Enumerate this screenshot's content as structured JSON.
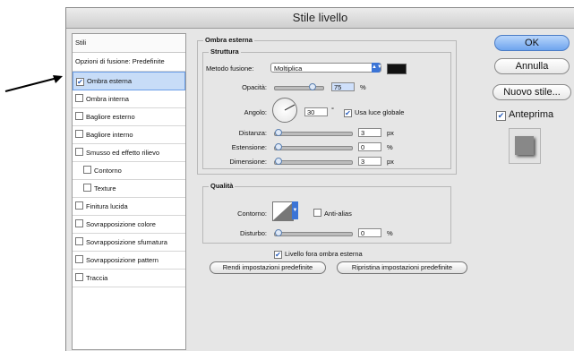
{
  "dialog": {
    "title": "Stile livello"
  },
  "styles_panel": {
    "header": "Stili",
    "blending": "Opzioni di fusione: Predefinite",
    "items": [
      {
        "label": "Ombra esterna",
        "checked": true,
        "selected": true,
        "indent": false
      },
      {
        "label": "Ombra interna",
        "checked": false,
        "indent": false
      },
      {
        "label": "Bagliore esterno",
        "checked": false,
        "indent": false
      },
      {
        "label": "Bagliore interno",
        "checked": false,
        "indent": false
      },
      {
        "label": "Smusso ed effetto rilievo",
        "checked": false,
        "indent": false
      },
      {
        "label": "Contorno",
        "checked": false,
        "indent": true
      },
      {
        "label": "Texture",
        "checked": false,
        "indent": true
      },
      {
        "label": "Finitura lucida",
        "checked": false,
        "indent": false
      },
      {
        "label": "Sovrapposizione colore",
        "checked": false,
        "indent": false
      },
      {
        "label": "Sovrapposizione sfumatura",
        "checked": false,
        "indent": false
      },
      {
        "label": "Sovrapposizione pattern",
        "checked": false,
        "indent": false
      },
      {
        "label": "Traccia",
        "checked": false,
        "indent": false
      }
    ]
  },
  "drop_shadow": {
    "title": "Ombra esterna",
    "structure_title": "Struttura",
    "blend_mode_label": "Metodo fusione:",
    "blend_mode_value": "Moltiplica",
    "shadow_color": "#111111",
    "opacity_label": "Opacità:",
    "opacity_value": "75",
    "opacity_unit": "%",
    "angle_label": "Angolo:",
    "angle_value": "30",
    "angle_unit": "°",
    "global_light_label": "Usa luce globale",
    "global_light_checked": true,
    "distance_label": "Distanza:",
    "distance_value": "3",
    "distance_unit": "px",
    "spread_label": "Estensione:",
    "spread_value": "0",
    "spread_unit": "%",
    "size_label": "Dimensione:",
    "size_value": "3",
    "size_unit": "px"
  },
  "quality": {
    "title": "Qualità",
    "contour_label": "Contorno:",
    "antialias_label": "Anti-alias",
    "antialias_checked": false,
    "noise_label": "Disturbo:",
    "noise_value": "0",
    "noise_unit": "%"
  },
  "knockout": {
    "label": "Livello fora ombra esterna",
    "checked": true
  },
  "buttons": {
    "make_default": "Rendi impostazioni predefinite",
    "reset_default": "Ripristina impostazioni predefinite",
    "ok": "OK",
    "cancel": "Annulla",
    "new_style": "Nuovo stile...",
    "preview_label": "Anteprima",
    "preview_checked": true
  },
  "colors": {
    "accent": "#3b74d6",
    "selection": "#c7dcf7"
  }
}
